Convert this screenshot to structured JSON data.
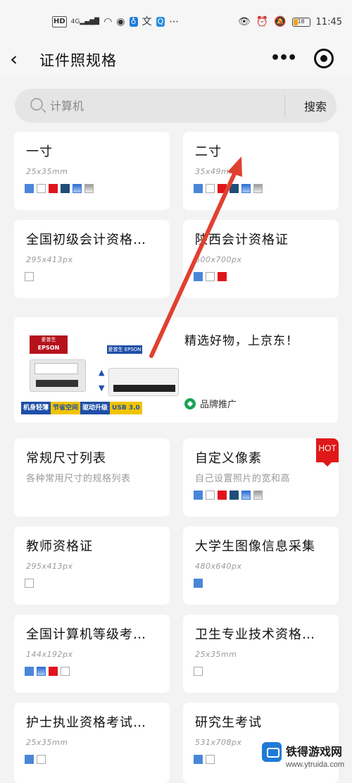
{
  "status_bar": {
    "network_left": "HD",
    "signal": "4G",
    "time": "11:45",
    "battery_level": "18",
    "icons": [
      "hd-icon",
      "signal-icon",
      "wifi-icon",
      "navigation-icon",
      "bulb-icon",
      "translate-icon",
      "search-app-icon",
      "ellipsis-icon",
      "eye-icon",
      "alarm-icon",
      "mute-icon",
      "battery-icon"
    ]
  },
  "header": {
    "back": "‹",
    "title": "证件照规格",
    "more": "•••"
  },
  "search": {
    "placeholder": "计算机",
    "button": "搜索"
  },
  "swatch_colors": {
    "blue": "#4a86d8",
    "white": "#ffffff",
    "red": "#e0151c",
    "navy": "#1f4e79",
    "gradient_blue": "#2f6fd1",
    "gradient_gray": "#999999"
  },
  "cards": [
    {
      "title": "一寸",
      "sub": "25x35mm",
      "swatches": [
        "blue",
        "white",
        "red",
        "navy",
        "gblue",
        "ggray"
      ]
    },
    {
      "title": "二寸",
      "sub": "35x49mm",
      "swatches": [
        "blue",
        "white",
        "red",
        "navy",
        "gblue",
        "ggray"
      ]
    },
    {
      "title": "全国初级会计资格…",
      "sub": "295x413px",
      "swatches": [
        "white"
      ]
    },
    {
      "title": "陕西会计资格证",
      "sub": "600x700px",
      "swatches": [
        "blue",
        "white",
        "red"
      ]
    },
    {
      "title": "常规尺寸列表",
      "sub": "各种常用尺寸的规格列表",
      "swatches": []
    },
    {
      "title": "自定义像素",
      "sub": "自己设置照片的宽和高",
      "swatches": [
        "blue",
        "white",
        "red",
        "navy",
        "gblue",
        "ggray"
      ],
      "badge": "HOT"
    },
    {
      "title": "教师资格证",
      "sub": "295x413px",
      "swatches": [
        "white"
      ]
    },
    {
      "title": "大学生图像信息采集",
      "sub": "480x640px",
      "swatches": [
        "blue"
      ]
    },
    {
      "title": "全国计算机等级考…",
      "sub": "144x192px",
      "swatches": [
        "blue",
        "gblue",
        "red",
        "white"
      ]
    },
    {
      "title": "卫生专业技术资格…",
      "sub": "25x35mm",
      "swatches": [
        "white"
      ]
    },
    {
      "title": "护士执业资格考试…",
      "sub": "25x35mm",
      "swatches": [
        "blue",
        "white"
      ]
    },
    {
      "title": "研究生考试",
      "sub": "531x708px",
      "swatches": [
        "blue",
        "white"
      ]
    }
  ],
  "ad": {
    "logo_top": "爱普生",
    "logo_brand": "EPSON",
    "brand_box": "爱普生 EPSON",
    "strip": [
      "机身轻薄",
      "节省空间",
      "驱动升级",
      "USB 3.0"
    ],
    "headline": "精选好物，上京东！",
    "tag": "品牌推广"
  },
  "watermark": {
    "title": "铁得游戏网",
    "url": "www.ytruida.com"
  }
}
